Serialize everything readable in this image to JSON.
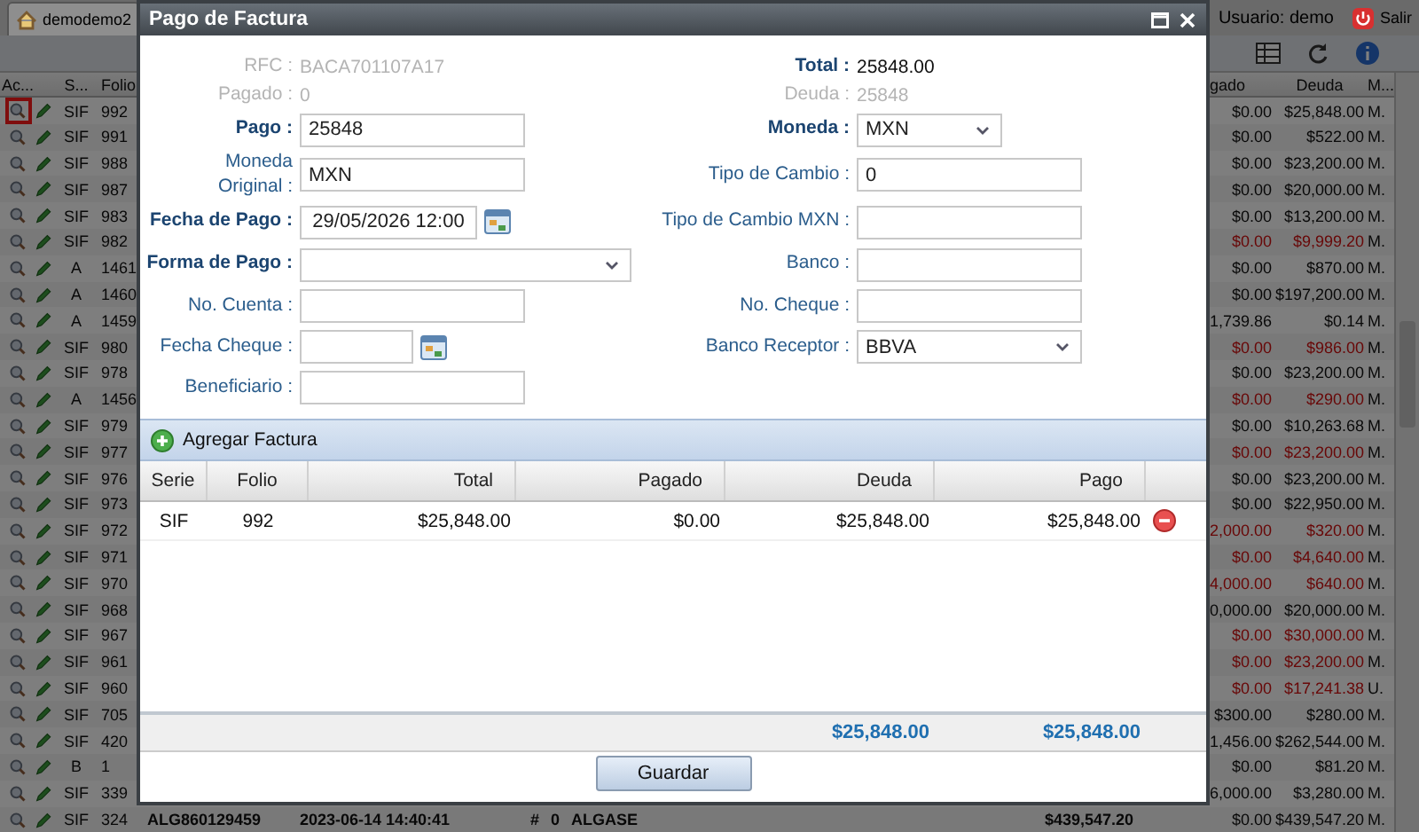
{
  "app": {
    "tab": "demodemo2",
    "user": "Usuario: demo",
    "logout": "Salir"
  },
  "grid": {
    "header": {
      "actions": "Ac...",
      "serie": "S...",
      "folio": "Folio",
      "pagado": "gado",
      "deuda": "Deuda",
      "moneda": "M..."
    },
    "rows": [
      {
        "serie": "SIF",
        "folio": "992",
        "pagado": "$0.00",
        "deuda": "$25,848.00",
        "moneda": "M.",
        "overdue": false,
        "highlighted": true
      },
      {
        "serie": "SIF",
        "folio": "991",
        "pagado": "$0.00",
        "deuda": "$522.00",
        "moneda": "M.",
        "overdue": false,
        "highlighted": false
      },
      {
        "serie": "SIF",
        "folio": "988",
        "pagado": "$0.00",
        "deuda": "$23,200.00",
        "moneda": "M.",
        "overdue": false,
        "highlighted": false
      },
      {
        "serie": "SIF",
        "folio": "987",
        "pagado": "$0.00",
        "deuda": "$20,000.00",
        "moneda": "M.",
        "overdue": false,
        "highlighted": false
      },
      {
        "serie": "SIF",
        "folio": "983",
        "pagado": "$0.00",
        "deuda": "$13,200.00",
        "moneda": "M.",
        "overdue": false,
        "highlighted": false
      },
      {
        "serie": "SIF",
        "folio": "982",
        "pagado": "$0.00",
        "deuda": "$9,999.20",
        "moneda": "M.",
        "overdue": true,
        "highlighted": false
      },
      {
        "serie": "A",
        "folio": "1461",
        "pagado": "$0.00",
        "deuda": "$870.00",
        "moneda": "M.",
        "overdue": false,
        "highlighted": false
      },
      {
        "serie": "A",
        "folio": "1460",
        "pagado": "$0.00",
        "deuda": "$197,200.00",
        "moneda": "M.",
        "overdue": false,
        "highlighted": false
      },
      {
        "serie": "A",
        "folio": "1459",
        "pagado": "1,739.86",
        "deuda": "$0.14",
        "moneda": "M.",
        "overdue": false,
        "highlighted": false
      },
      {
        "serie": "SIF",
        "folio": "980",
        "pagado": "$0.00",
        "deuda": "$986.00",
        "moneda": "M.",
        "overdue": true,
        "highlighted": false
      },
      {
        "serie": "SIF",
        "folio": "978",
        "pagado": "$0.00",
        "deuda": "$23,200.00",
        "moneda": "M.",
        "overdue": false,
        "highlighted": false
      },
      {
        "serie": "A",
        "folio": "1456",
        "pagado": "$0.00",
        "deuda": "$290.00",
        "moneda": "M.",
        "overdue": true,
        "highlighted": false
      },
      {
        "serie": "SIF",
        "folio": "979",
        "pagado": "$0.00",
        "deuda": "$10,263.68",
        "moneda": "M.",
        "overdue": false,
        "highlighted": false
      },
      {
        "serie": "SIF",
        "folio": "977",
        "pagado": "$0.00",
        "deuda": "$23,200.00",
        "moneda": "M.",
        "overdue": true,
        "highlighted": false
      },
      {
        "serie": "SIF",
        "folio": "976",
        "pagado": "$0.00",
        "deuda": "$23,200.00",
        "moneda": "M.",
        "overdue": false,
        "highlighted": false
      },
      {
        "serie": "SIF",
        "folio": "973",
        "pagado": "$0.00",
        "deuda": "$22,950.00",
        "moneda": "M.",
        "overdue": false,
        "highlighted": false
      },
      {
        "serie": "SIF",
        "folio": "972",
        "pagado": "2,000.00",
        "deuda": "$320.00",
        "moneda": "M.",
        "overdue": true,
        "highlighted": false
      },
      {
        "serie": "SIF",
        "folio": "971",
        "pagado": "$0.00",
        "deuda": "$4,640.00",
        "moneda": "M.",
        "overdue": true,
        "highlighted": false
      },
      {
        "serie": "SIF",
        "folio": "970",
        "pagado": "4,000.00",
        "deuda": "$640.00",
        "moneda": "M.",
        "overdue": true,
        "highlighted": false
      },
      {
        "serie": "SIF",
        "folio": "968",
        "pagado": "0,000.00",
        "deuda": "$20,000.00",
        "moneda": "M.",
        "overdue": false,
        "highlighted": false
      },
      {
        "serie": "SIF",
        "folio": "967",
        "pagado": "$0.00",
        "deuda": "$30,000.00",
        "moneda": "M.",
        "overdue": true,
        "highlighted": false
      },
      {
        "serie": "SIF",
        "folio": "961",
        "pagado": "$0.00",
        "deuda": "$23,200.00",
        "moneda": "M.",
        "overdue": true,
        "highlighted": false
      },
      {
        "serie": "SIF",
        "folio": "960",
        "pagado": "$0.00",
        "deuda": "$17,241.38",
        "moneda": "U.",
        "overdue": true,
        "highlighted": false
      },
      {
        "serie": "SIF",
        "folio": "705",
        "pagado": "$300.00",
        "deuda": "$280.00",
        "moneda": "M.",
        "overdue": false,
        "highlighted": false
      },
      {
        "serie": "SIF",
        "folio": "420",
        "pagado": "1,456.00",
        "deuda": "$262,544.00",
        "moneda": "M.",
        "overdue": false,
        "highlighted": false
      },
      {
        "serie": "B",
        "folio": "1",
        "pagado": "$0.00",
        "deuda": "$81.20",
        "moneda": "M.",
        "overdue": false,
        "highlighted": false
      },
      {
        "serie": "SIF",
        "folio": "339",
        "pagado": "6,000.00",
        "deuda": "$3,280.00",
        "moneda": "M.",
        "overdue": false,
        "highlighted": false
      },
      {
        "serie": "SIF",
        "folio": "324",
        "rfc": "ALG860129459",
        "fecha": "2023-06-14 14:40:41",
        "column_6": "#",
        "column_7": "0",
        "nombre": "ALGASE",
        "total": "$439,547.20",
        "pagado": "$0.00",
        "deuda": "$439,547.20",
        "moneda": "M.",
        "overdue": false,
        "highlighted": false
      }
    ]
  },
  "dialog": {
    "title": "Pago de Factura",
    "left_fields": [
      {
        "label": "RFC :",
        "kind": "info",
        "value": "BACA701107A17",
        "disabled": true
      },
      {
        "label": "Pagado :",
        "kind": "info",
        "value": "0",
        "disabled": true
      },
      {
        "label": "Pago :",
        "kind": "text",
        "value": "25848",
        "required": true
      },
      {
        "label": "Moneda\nOriginal :",
        "kind": "text",
        "value": "MXN",
        "required": false
      },
      {
        "label": "Fecha de Pago :",
        "kind": "date",
        "value": "29/05/2026 12:00",
        "required": true
      },
      {
        "label": "Forma de Pago :",
        "kind": "select",
        "required": true
      },
      {
        "label": "No. Cuenta :",
        "kind": "text",
        "required": false
      },
      {
        "label": "Fecha Cheque :",
        "kind": "date",
        "required": false
      },
      {
        "label": "Beneficiario :",
        "kind": "text",
        "required": false
      }
    ],
    "right_fields": [
      {
        "label": "Total :",
        "kind": "info",
        "value": "25848.00",
        "disabled": false,
        "required": true
      },
      {
        "label": "Deuda :",
        "kind": "info",
        "value": "25848",
        "disabled": true
      },
      {
        "label": "Moneda :",
        "kind": "select",
        "value": "MXN",
        "required": true
      },
      {
        "label": "Tipo de Cambio :",
        "kind": "text",
        "value": "0",
        "required": false
      },
      {
        "label": "Tipo de Cambio MXN :",
        "kind": "text",
        "required": false
      },
      {
        "label": "Banco :",
        "kind": "text",
        "required": false
      },
      {
        "label": "No. Cheque :",
        "kind": "text",
        "required": false
      },
      {
        "label": "Banco Receptor :",
        "kind": "select",
        "value": "BBVA",
        "required": false
      }
    ],
    "add_label": "Agregar Factura",
    "columns": [
      "Serie",
      "Folio",
      "Total",
      "Pagado",
      "Deuda",
      "Pago"
    ],
    "rows": [
      {
        "serie": "SIF",
        "folio": "992",
        "total": "$25,848.00",
        "pagado": "$0.00",
        "deuda": "$25,848.00",
        "pago": "$25,848.00"
      }
    ],
    "totals": {
      "deuda": "$25,848.00",
      "pago": "$25,848.00"
    },
    "save_label": "Guardar"
  }
}
